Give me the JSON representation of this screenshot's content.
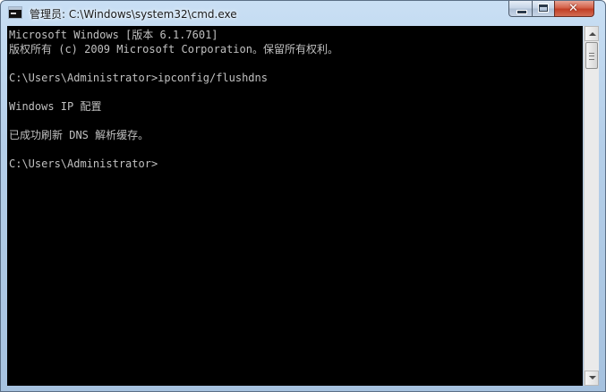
{
  "window": {
    "title": "管理员: C:\\Windows\\system32\\cmd.exe",
    "icon": "cmd-icon"
  },
  "controls": {
    "minimize": "minimize-icon",
    "maximize": "maximize-icon",
    "close_glyph": "✕"
  },
  "console": {
    "lines": [
      "Microsoft Windows [版本 6.1.7601]",
      "版权所有 (c) 2009 Microsoft Corporation。保留所有权利。",
      "",
      "C:\\Users\\Administrator>ipconfig/flushdns",
      "",
      "Windows IP 配置",
      "",
      "已成功刷新 DNS 解析缓存。",
      "",
      "C:\\Users\\Administrator>"
    ]
  },
  "colors": {
    "console_background": "#000000",
    "console_text": "#c0c0c0",
    "close_button": "#c94a30"
  }
}
